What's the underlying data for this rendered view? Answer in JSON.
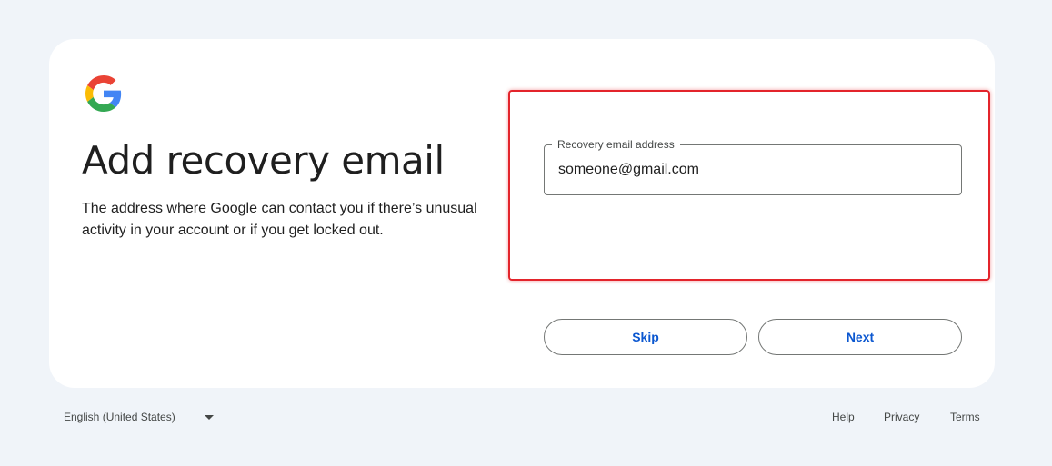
{
  "page": {
    "heading": "Add recovery email",
    "description": "The address where Google can contact you if there’s unusual activity in your account or if you get locked out."
  },
  "logo": {
    "icon": "google-g-icon"
  },
  "recovery_field": {
    "label": "Recovery email address",
    "value": "someone@gmail.com",
    "placeholder": ""
  },
  "buttons": {
    "skip_label": "Skip",
    "next_label": "Next"
  },
  "footer": {
    "language": "English (United States)",
    "help": "Help",
    "privacy": "Privacy",
    "terms": "Terms"
  },
  "colors": {
    "background": "#f0f4f9",
    "card": "#ffffff",
    "accent": "#0b57d0",
    "highlight": "#e3242b"
  }
}
